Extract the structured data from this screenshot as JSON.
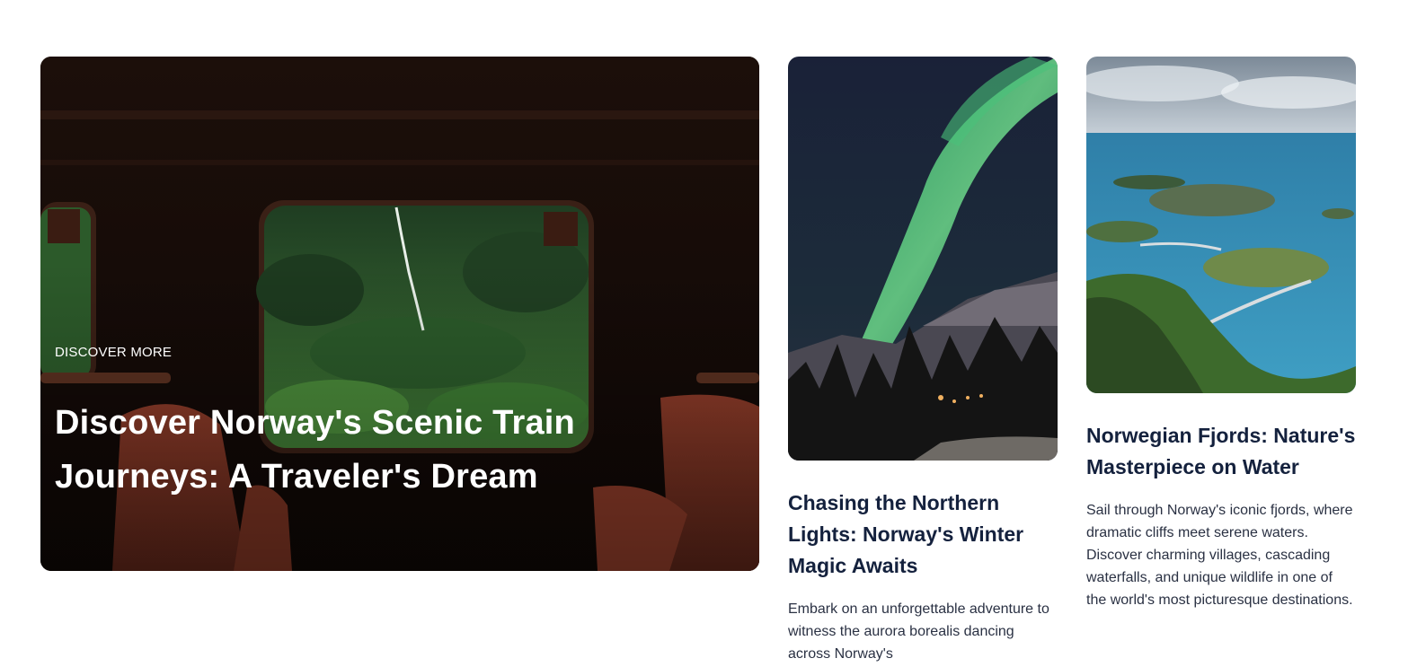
{
  "featured": {
    "kicker": "DISCOVER MORE",
    "title": "Discover Norway's Scenic Train Journeys: A Traveler's Dream"
  },
  "cards": [
    {
      "title": "Chasing the Northern Lights: Norway's Winter Magic Awaits",
      "excerpt": "Embark on an unforgettable adventure to witness the aurora borealis dancing across Norway's"
    },
    {
      "title": "Norwegian Fjords: Nature's Masterpiece on Water",
      "excerpt": "Sail through Norway's iconic fjords, where dramatic cliffs meet serene waters. Discover charming villages, cascading waterfalls, and unique wildlife in one of the world's most picturesque destinations."
    }
  ],
  "colors": {
    "heading": "#14213d",
    "body_text": "#2a3143",
    "overlay_text": "#ffffff"
  }
}
